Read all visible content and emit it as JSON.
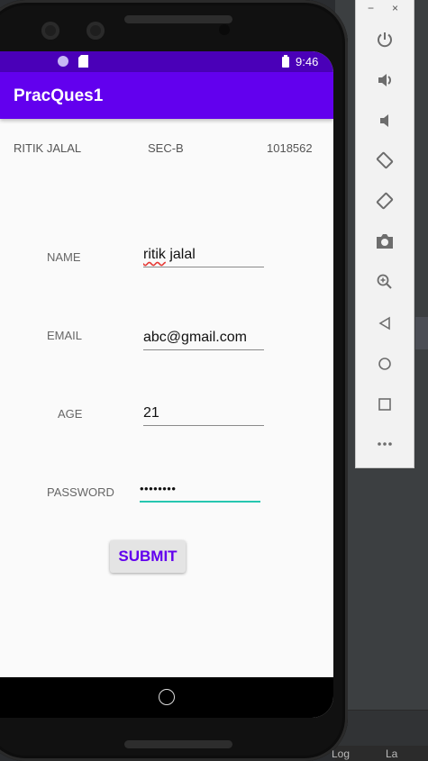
{
  "status_bar": {
    "time": "9:46"
  },
  "app_bar": {
    "title": "PracQues1"
  },
  "header": {
    "name": "RITIK JALAL",
    "section": "SEC-B",
    "roll": "1018562"
  },
  "form": {
    "name_label": "NAME",
    "name_value_misspelled": "ritik",
    "name_value_rest": " jalal",
    "email_label": "EMAIL",
    "email_value": "abc@gmail.com",
    "age_label": "AGE",
    "age_value": "21",
    "password_label": "PASSWORD",
    "password_value": "••••••••"
  },
  "submit_label": "SUBMIT",
  "emulator": {
    "minimize": "−",
    "close": "×",
    "tools": [
      "power-icon",
      "volume-up-icon",
      "volume-down-icon",
      "rotate-left-icon",
      "rotate-right-icon",
      "screenshot-icon",
      "zoom-icon",
      "back-icon",
      "home-icon",
      "overview-icon",
      "more-icon"
    ]
  },
  "ide": {
    "tab1": "Log",
    "tab2": "La"
  },
  "colors": {
    "primary": "#6200ee",
    "primary_dark": "#4a00b8",
    "accent": "#26c6b0"
  }
}
